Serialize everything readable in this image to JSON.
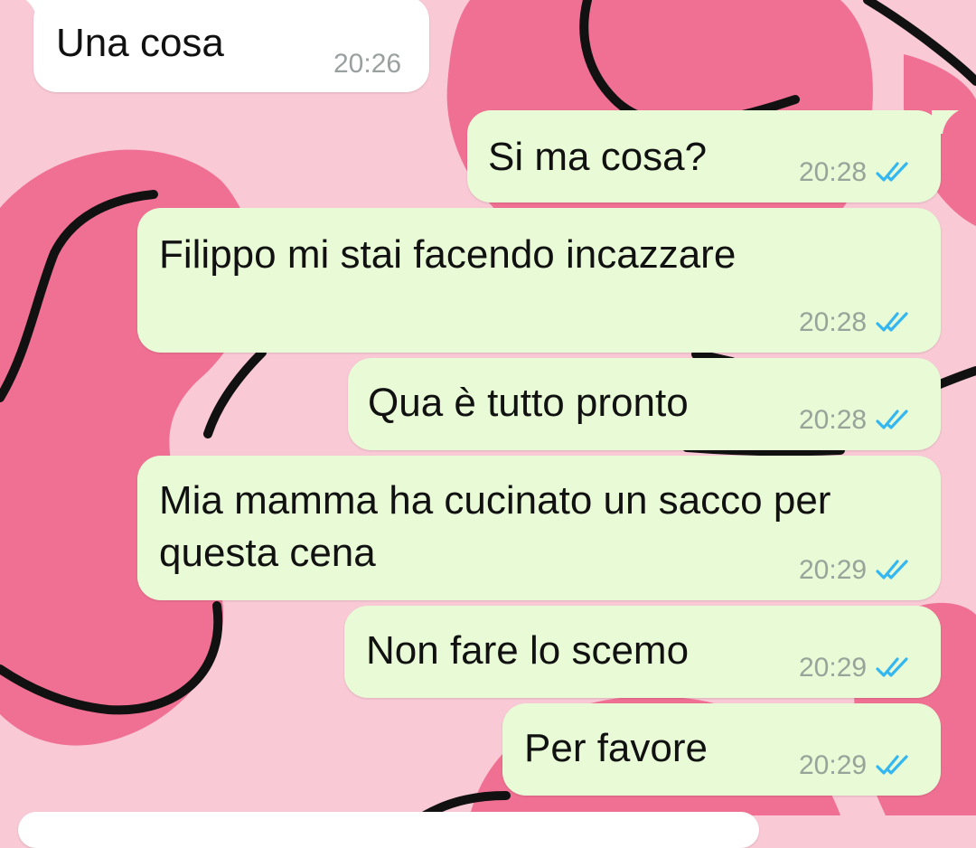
{
  "colors": {
    "background": "#f9c9d5",
    "blob": "#f07093",
    "outgoing_bubble": "#e8fbd6",
    "incoming_bubble": "#ffffff",
    "read_tick": "#34b7f1"
  },
  "messages": [
    {
      "direction": "incoming",
      "lines": [
        "Una cosa"
      ],
      "time": "20:26"
    },
    {
      "direction": "outgoing",
      "lines": [
        "Si ma cosa?"
      ],
      "time": "20:28",
      "status_icon": "double-check-read-icon"
    },
    {
      "direction": "outgoing",
      "lines": [
        "Filippo mi stai facendo incazzare"
      ],
      "time": "20:28",
      "status_icon": "double-check-read-icon"
    },
    {
      "direction": "outgoing",
      "lines": [
        "Qua è tutto pronto"
      ],
      "time": "20:28",
      "status_icon": "double-check-read-icon"
    },
    {
      "direction": "outgoing",
      "lines": [
        "Mia mamma ha cucinato un sacco per",
        "questa cena"
      ],
      "time": "20:29",
      "status_icon": "double-check-read-icon"
    },
    {
      "direction": "outgoing",
      "lines": [
        "Non fare lo scemo"
      ],
      "time": "20:29",
      "status_icon": "double-check-read-icon"
    },
    {
      "direction": "outgoing",
      "lines": [
        "Per favore"
      ],
      "time": "20:29",
      "status_icon": "double-check-read-icon"
    }
  ]
}
